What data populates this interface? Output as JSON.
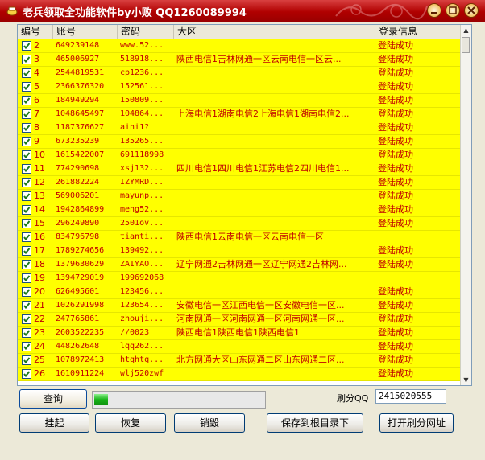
{
  "window": {
    "title": "老兵领取全功能软件by小败 QQ1260089994"
  },
  "table": {
    "columns": [
      "编号",
      "账号",
      "密码",
      "大区",
      "登录信息"
    ],
    "rows": [
      {
        "no": "2",
        "account": "649239148",
        "password": "www.52...",
        "region": "",
        "status": "登陆成功"
      },
      {
        "no": "3",
        "account": "465006927",
        "password": "518918...",
        "region": "陕西电信1吉林网通一区云南电信一区云...",
        "status": "登陆成功"
      },
      {
        "no": "4",
        "account": "2544819531",
        "password": "cp1236...",
        "region": "",
        "status": "登陆成功"
      },
      {
        "no": "5",
        "account": "2366376320",
        "password": "152561...",
        "region": "",
        "status": "登陆成功"
      },
      {
        "no": "6",
        "account": "184949294",
        "password": "150809...",
        "region": "",
        "status": "登陆成功"
      },
      {
        "no": "7",
        "account": "1048645497",
        "password": "104864...",
        "region": "上海电信1湖南电信2上海电信1湖南电信2...",
        "status": "登陆成功"
      },
      {
        "no": "8",
        "account": "1187376627",
        "password": "aini1?",
        "region": "",
        "status": "登陆成功"
      },
      {
        "no": "9",
        "account": "673235239",
        "password": "135265...",
        "region": "",
        "status": "登陆成功"
      },
      {
        "no": "10",
        "account": "1615422007",
        "password": "691118998",
        "region": "",
        "status": "登陆成功"
      },
      {
        "no": "11",
        "account": "774290698",
        "password": "xsj132...",
        "region": "四川电信1四川电信1江苏电信2四川电信1...",
        "status": "登陆成功"
      },
      {
        "no": "12",
        "account": "261882224",
        "password": "IZYMRD...",
        "region": "",
        "status": "登陆成功"
      },
      {
        "no": "13",
        "account": "569006201",
        "password": "mayunp...",
        "region": "",
        "status": "登陆成功"
      },
      {
        "no": "14",
        "account": "1942864899",
        "password": "meng52...",
        "region": "",
        "status": "登陆成功"
      },
      {
        "no": "15",
        "account": "296249890",
        "password": "2501ov...",
        "region": "",
        "status": "登陆成功"
      },
      {
        "no": "16",
        "account": "834796798",
        "password": "tianti...",
        "region": "陕西电信1云南电信一区云南电信一区",
        "status": ""
      },
      {
        "no": "17",
        "account": "1789274656",
        "password": "139492...",
        "region": "",
        "status": "登陆成功"
      },
      {
        "no": "18",
        "account": "1379630629",
        "password": "ZAIYAO...",
        "region": "辽宁网通2吉林网通一区辽宁网通2吉林网...",
        "status": "登陆成功"
      },
      {
        "no": "19",
        "account": "1394729019",
        "password": "199692068",
        "region": "",
        "status": ""
      },
      {
        "no": "20",
        "account": "626495601",
        "password": "123456...",
        "region": "",
        "status": "登陆成功"
      },
      {
        "no": "21",
        "account": "1026291998",
        "password": "123654...",
        "region": "安徽电信一区江西电信一区安徽电信一区...",
        "status": "登陆成功"
      },
      {
        "no": "22",
        "account": "247765861",
        "password": "zhouji...",
        "region": "河南网通一区河南网通一区河南网通一区...",
        "status": "登陆成功"
      },
      {
        "no": "23",
        "account": "2603522235",
        "password": "//0023",
        "region": "陕西电信1陕西电信1陕西电信1",
        "status": "登陆成功"
      },
      {
        "no": "24",
        "account": "448262648",
        "password": "lqq262...",
        "region": "",
        "status": "登陆成功"
      },
      {
        "no": "25",
        "account": "1078972413",
        "password": "htqhtq...",
        "region": "北方网通大区山东网通二区山东网通二区...",
        "status": "登陆成功"
      },
      {
        "no": "26",
        "account": "1610911224",
        "password": "wlj520zwf",
        "region": "",
        "status": "登陆成功"
      }
    ]
  },
  "controls": {
    "query_label": "查询",
    "refresh_qq_label": "刷分QQ",
    "refresh_qq_value": "2415020555",
    "progress_fraction": 0.08,
    "hang_label": "挂起",
    "restore_label": "恢复",
    "destroy_label": "销毁",
    "save_label": "保存到根目录下",
    "open_url_label": "打开刷分网址"
  },
  "colors": {
    "row_bg": "#ffff00",
    "text_red": "#c00000",
    "title_bar": "#b00000"
  }
}
